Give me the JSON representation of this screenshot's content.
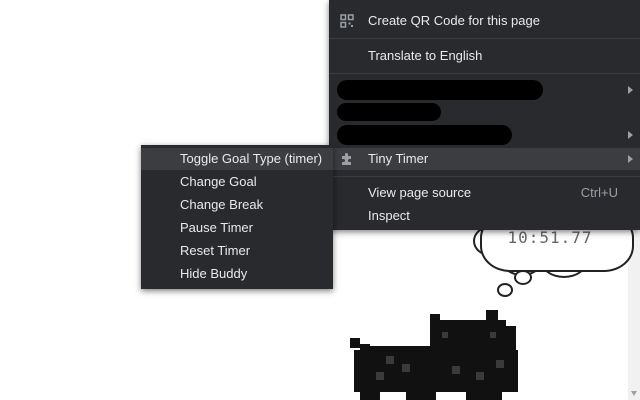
{
  "main_menu": {
    "create_qr": "Create QR Code for this page",
    "translate": "Translate to English",
    "tiny_timer": "Tiny Timer",
    "view_source": "View page source",
    "view_source_shortcut": "Ctrl+U",
    "inspect": "Inspect"
  },
  "sub_menu": {
    "items": [
      "Toggle Goal Type (timer)",
      "Change Goal",
      "Change Break",
      "Pause Timer",
      "Reset Timer",
      "Hide Buddy"
    ]
  },
  "buddy": {
    "time": "10:51.77"
  },
  "colors": {
    "menu_bg": "#292a2d",
    "menu_text": "#e8eaed",
    "highlight": "#3c3d41"
  }
}
